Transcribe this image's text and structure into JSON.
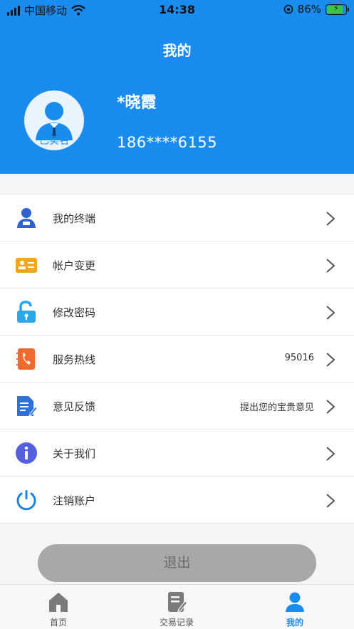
{
  "status_bar": {
    "carrier": "中国移动",
    "time": "14:38",
    "battery_percent": "86%",
    "battery_level": 0.86
  },
  "header": {
    "title": "我的",
    "user_name": "*晓霞",
    "user_phone": "186****6155",
    "avatar_badge": "已实名",
    "bg_color": "#1a8cf0"
  },
  "menu": {
    "items": [
      {
        "label": "我的终端",
        "extra": "",
        "icon": "user-card-icon"
      },
      {
        "label": "帐户变更",
        "extra": "",
        "icon": "id-card-icon"
      },
      {
        "label": "修改密码",
        "extra": "",
        "icon": "unlock-icon"
      },
      {
        "label": "服务热线",
        "extra": "95016",
        "icon": "phone-book-icon"
      },
      {
        "label": "意见反馈",
        "extra": "提出您的宝贵意见",
        "icon": "document-edit-icon"
      },
      {
        "label": "关于我们",
        "extra": "",
        "icon": "info-icon"
      },
      {
        "label": "注销账户",
        "extra": "",
        "icon": "power-icon"
      }
    ]
  },
  "logout_label": "退出",
  "tabbar": {
    "tabs": [
      {
        "label": "首页",
        "icon": "home-icon"
      },
      {
        "label": "交易记录",
        "icon": "transaction-record-icon"
      },
      {
        "label": "我的",
        "icon": "profile-icon",
        "active": true
      }
    ]
  }
}
